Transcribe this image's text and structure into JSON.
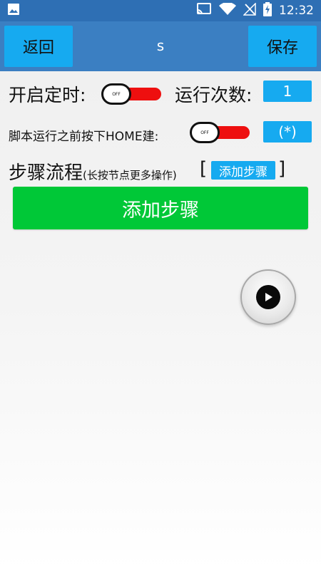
{
  "status_bar": {
    "time": "12:32",
    "icons": [
      "image-icon",
      "cast-icon",
      "wifi-icon",
      "signal-off-icon",
      "battery-charging-icon"
    ]
  },
  "app_bar": {
    "back_label": "返回",
    "title": "s",
    "save_label": "保存"
  },
  "timer_row": {
    "label": "开启定时:",
    "toggle_text": "OFF",
    "runs_label": "运行次数:",
    "runs_value": "1"
  },
  "home_row": {
    "label": "脚本运行之前按下HOME建:",
    "toggle_text": "OFF",
    "value": "(*)"
  },
  "steps": {
    "title": "步骤流程",
    "subtitle": "(长按节点更多操作)",
    "bracket_open": "[",
    "bracket_close": "]",
    "add_small_label": "添加步骤",
    "add_big_label": "添加步骤"
  },
  "colors": {
    "status_bar": "#2e6fb4",
    "app_bar": "#3b7fc2",
    "button_blue": "#16aaf0",
    "toggle_red": "#ee0f0f",
    "add_green": "#00c837"
  }
}
